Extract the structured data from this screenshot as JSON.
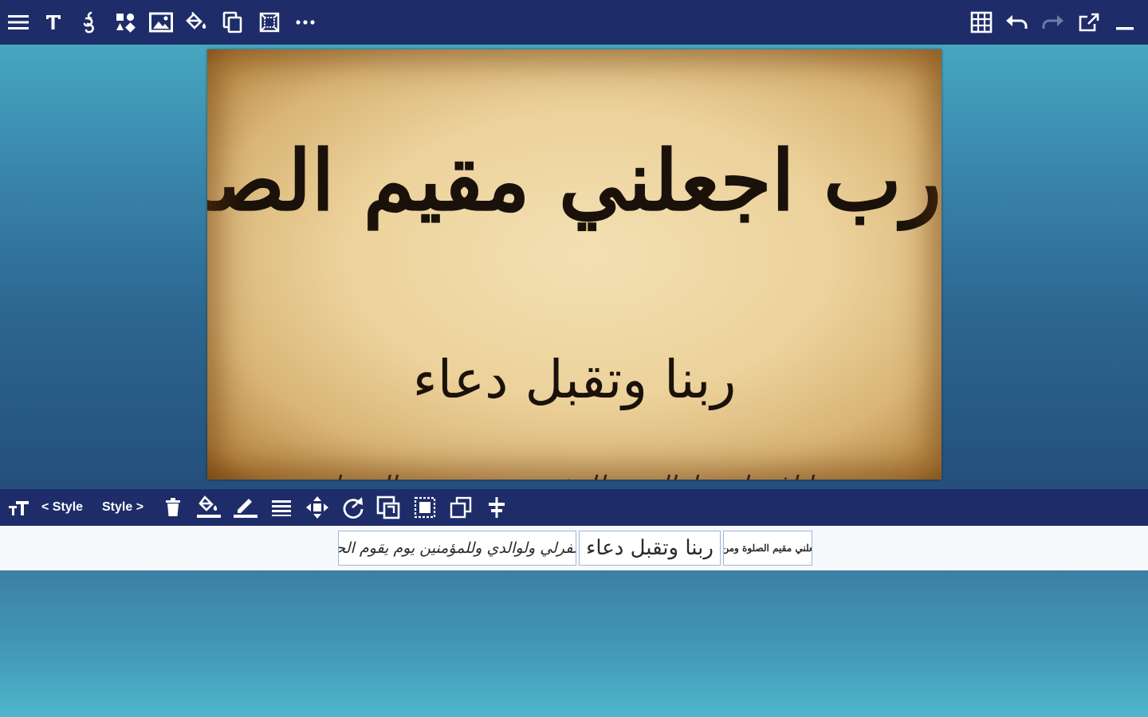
{
  "top_toolbar": {
    "left_tools": [
      "menu-icon",
      "text-icon",
      "symbol-icon",
      "shapes-icon",
      "image-icon",
      "fill-bucket-icon",
      "copy-page-icon",
      "frame-icon",
      "more-icon"
    ],
    "right_tools": [
      "grid-icon",
      "undo-icon",
      "redo-icon",
      "share-icon",
      "minimize-icon"
    ]
  },
  "canvas": {
    "line1": "رب اجعلني مقيم الصلوة ومن ذريتي",
    "line2": "ربنا وتقبل دعاء",
    "line3": "ربنا اغفرلي ولوالدي وللمؤمنين يوم يقوم الحساب"
  },
  "edit_toolbar": {
    "prev_style_label": "< Style",
    "next_style_label": "Style >"
  },
  "thumbnails": [
    {
      "text": "ربنا اغفرلي ولوالدي وللمؤمنين يوم يقوم الحساب"
    },
    {
      "text": "ربنا وتقبل دعاء"
    },
    {
      "text": "رب اجعلني مقيم الصلوة ومن ذريتي"
    }
  ],
  "colors": {
    "toolbar": "#1e2d69",
    "icon": "#ffffff",
    "icon_disabled": "#6f7aa3",
    "thumb_border": "#9db6dd"
  }
}
